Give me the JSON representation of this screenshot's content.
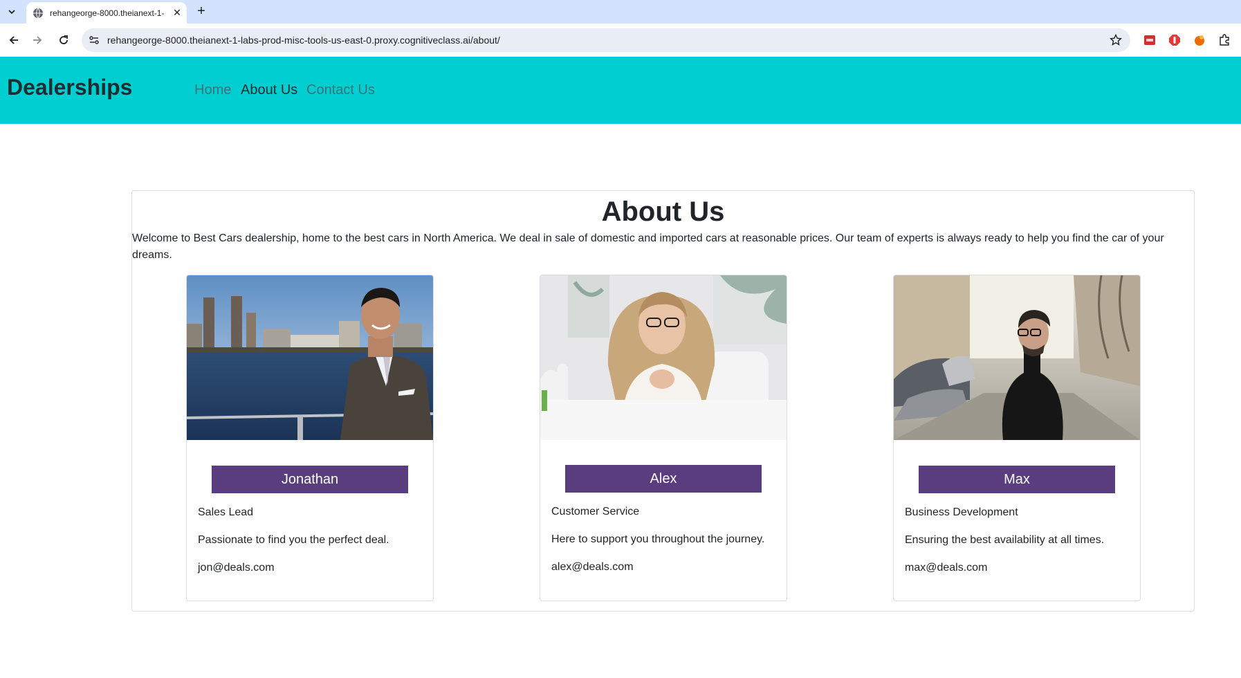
{
  "browser": {
    "tab_title": "rehangeorge-8000.theianext-1-",
    "url": "rehangeorge-8000.theianext-1-labs-prod-misc-tools-us-east-0.proxy.cognitiveclass.ai/about/",
    "icons": [
      "tab-search-icon",
      "globe-icon",
      "close-icon",
      "plus-icon",
      "back-icon",
      "forward-icon",
      "reload-icon",
      "site-info-icon",
      "bookmark-star-icon",
      "extension-red-icon",
      "extension-adblock-icon",
      "extension-orange-icon",
      "puzzle-icon"
    ]
  },
  "navbar": {
    "brand": "Dealerships",
    "links": [
      "Home",
      "About Us",
      "Contact Us"
    ],
    "active": "About Us",
    "bg_color": "#00ced1"
  },
  "about": {
    "title": "About Us",
    "intro": "Welcome to Best Cars dealership, home to the best cars in North America. We deal in sale of domestic and imported cars at reasonable prices. Our team of experts is always ready to help you find the car of your dreams."
  },
  "team": [
    {
      "name": "Jonathan",
      "role": "Sales Lead",
      "description": "Passionate to find you the perfect deal.",
      "email": "jon@deals.com"
    },
    {
      "name": "Alex",
      "role": "Customer Service",
      "description": "Here to support you throughout the journey.",
      "email": "alex@deals.com"
    },
    {
      "name": "Max",
      "role": "Business Development",
      "description": "Ensuring the best availability at all times.",
      "email": "max@deals.com"
    }
  ],
  "colors": {
    "name_button": "#5a3d7e"
  }
}
